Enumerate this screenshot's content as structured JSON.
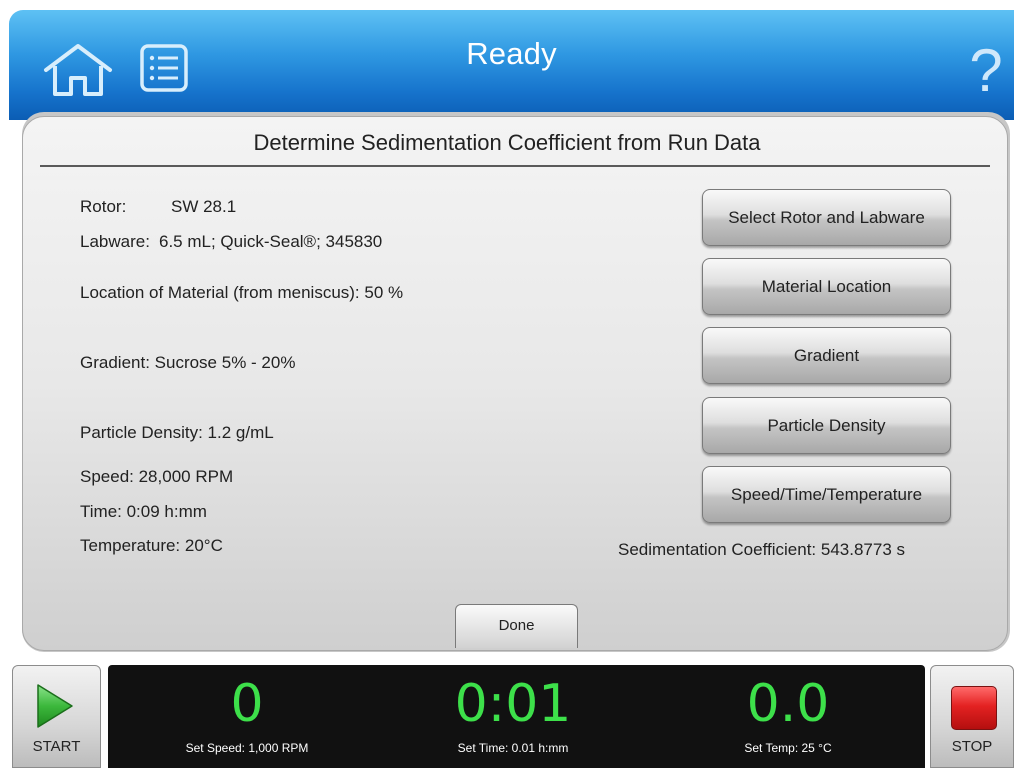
{
  "header": {
    "title": "Ready",
    "icons": {
      "home": "home-icon",
      "list": "list-icon",
      "help": "help-icon"
    },
    "help_glyph": "?"
  },
  "panel": {
    "title": "Determine Sedimentation Coefficient from Run Data",
    "rotor": {
      "label": "Rotor:",
      "value": "SW 28.1"
    },
    "labware": {
      "label": "Labware:",
      "value": "6.5 mL; Quick-Seal®; 345830"
    },
    "location": "Location of Material (from meniscus): 50 %",
    "gradient": "Gradient: Sucrose 5% - 20%",
    "density": "Particle Density: 1.2 g/mL",
    "speed": "Speed: 28,000 RPM",
    "time": "Time: 0:09 h:mm",
    "temperature": "Temperature: 20°C",
    "buttons": {
      "select_rotor": "Select Rotor and Labware",
      "material_location": "Material Location",
      "gradient": "Gradient",
      "particle_density": "Particle Density",
      "speed_time_temp": "Speed/Time/Temperature"
    },
    "sedimentation_result": "Sedimentation Coefficient: 543.8773 s",
    "done": "Done"
  },
  "controls": {
    "start": "START",
    "stop": "STOP",
    "speed": {
      "value": "0",
      "set": "Set Speed: 1,000 RPM"
    },
    "time": {
      "value": "0:01",
      "set": "Set Time: 0.01 h:mm"
    },
    "temp": {
      "value": "0.0",
      "set": "Set Temp: 25 °C"
    }
  },
  "colors": {
    "header_blue": "#1673cc",
    "readout_green": "#3de04a",
    "start_green": "#3cb83c",
    "stop_red": "#e42222",
    "status_bg": "#111111"
  }
}
